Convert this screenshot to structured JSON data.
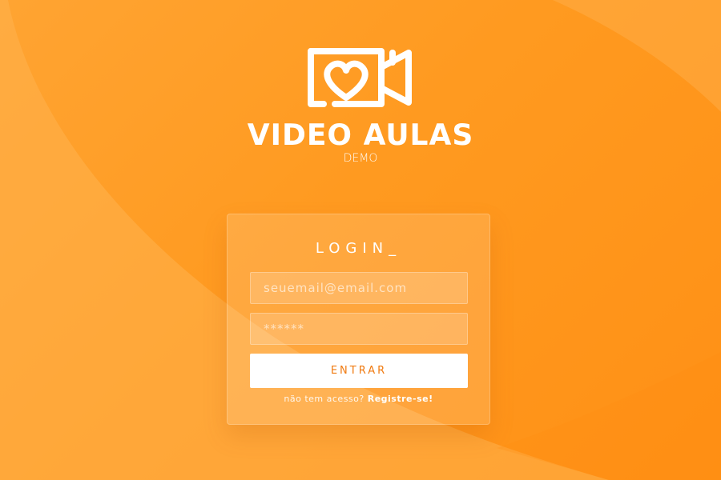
{
  "brand": {
    "title": "VIDEO AULAS",
    "subtitle": "DEMO",
    "logo_icon": "video-camera-heart-icon"
  },
  "login": {
    "title": "LOGIN_",
    "email_placeholder": "seuemail@email.com",
    "password_placeholder": "******",
    "submit_label": "ENTRAR",
    "register_prefix": "não tem acesso?",
    "register_link": "Registre-se!"
  },
  "colors": {
    "background_primary": "#ff9a20",
    "background_light": "#ffa432",
    "button_text": "#f07a10",
    "white": "#ffffff"
  }
}
